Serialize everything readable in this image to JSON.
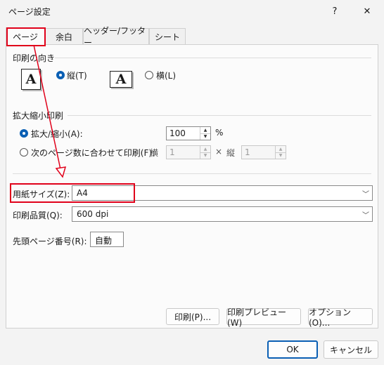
{
  "window": {
    "title": "ページ設定",
    "help_label": "?",
    "close_label": "✕"
  },
  "tabs": [
    {
      "label": "ページ"
    },
    {
      "label": "余白"
    },
    {
      "label": "ヘッダー/フッター"
    },
    {
      "label": "シート"
    }
  ],
  "orientation": {
    "section_title": "印刷の向き",
    "portrait_label": "縦(T)",
    "landscape_label": "横(L)",
    "icon_letter": "A",
    "selected": "portrait"
  },
  "scaling": {
    "section_title": "拡大縮小印刷",
    "zoom_label": "拡大/縮小(A):",
    "zoom_value": "100",
    "zoom_unit": "%",
    "fit_label": "次のページ数に合わせて印刷(F):",
    "wide_label": "横",
    "wide_value": "1",
    "times": "×",
    "tall_label": "縦",
    "tall_value": "1",
    "selected": "zoom"
  },
  "paper": {
    "label": "用紙サイズ(Z):",
    "value": "A4"
  },
  "quality": {
    "label": "印刷品質(Q):",
    "value": "600 dpi"
  },
  "first_page": {
    "label": "先頭ページ番号(R):",
    "value": "自動"
  },
  "buttons": {
    "print": "印刷(P)...",
    "preview": "印刷プレビュー(W)",
    "options": "オプション(O)...",
    "ok": "OK",
    "cancel": "キャンセル"
  },
  "annotation": {
    "color": "#e0001a"
  }
}
